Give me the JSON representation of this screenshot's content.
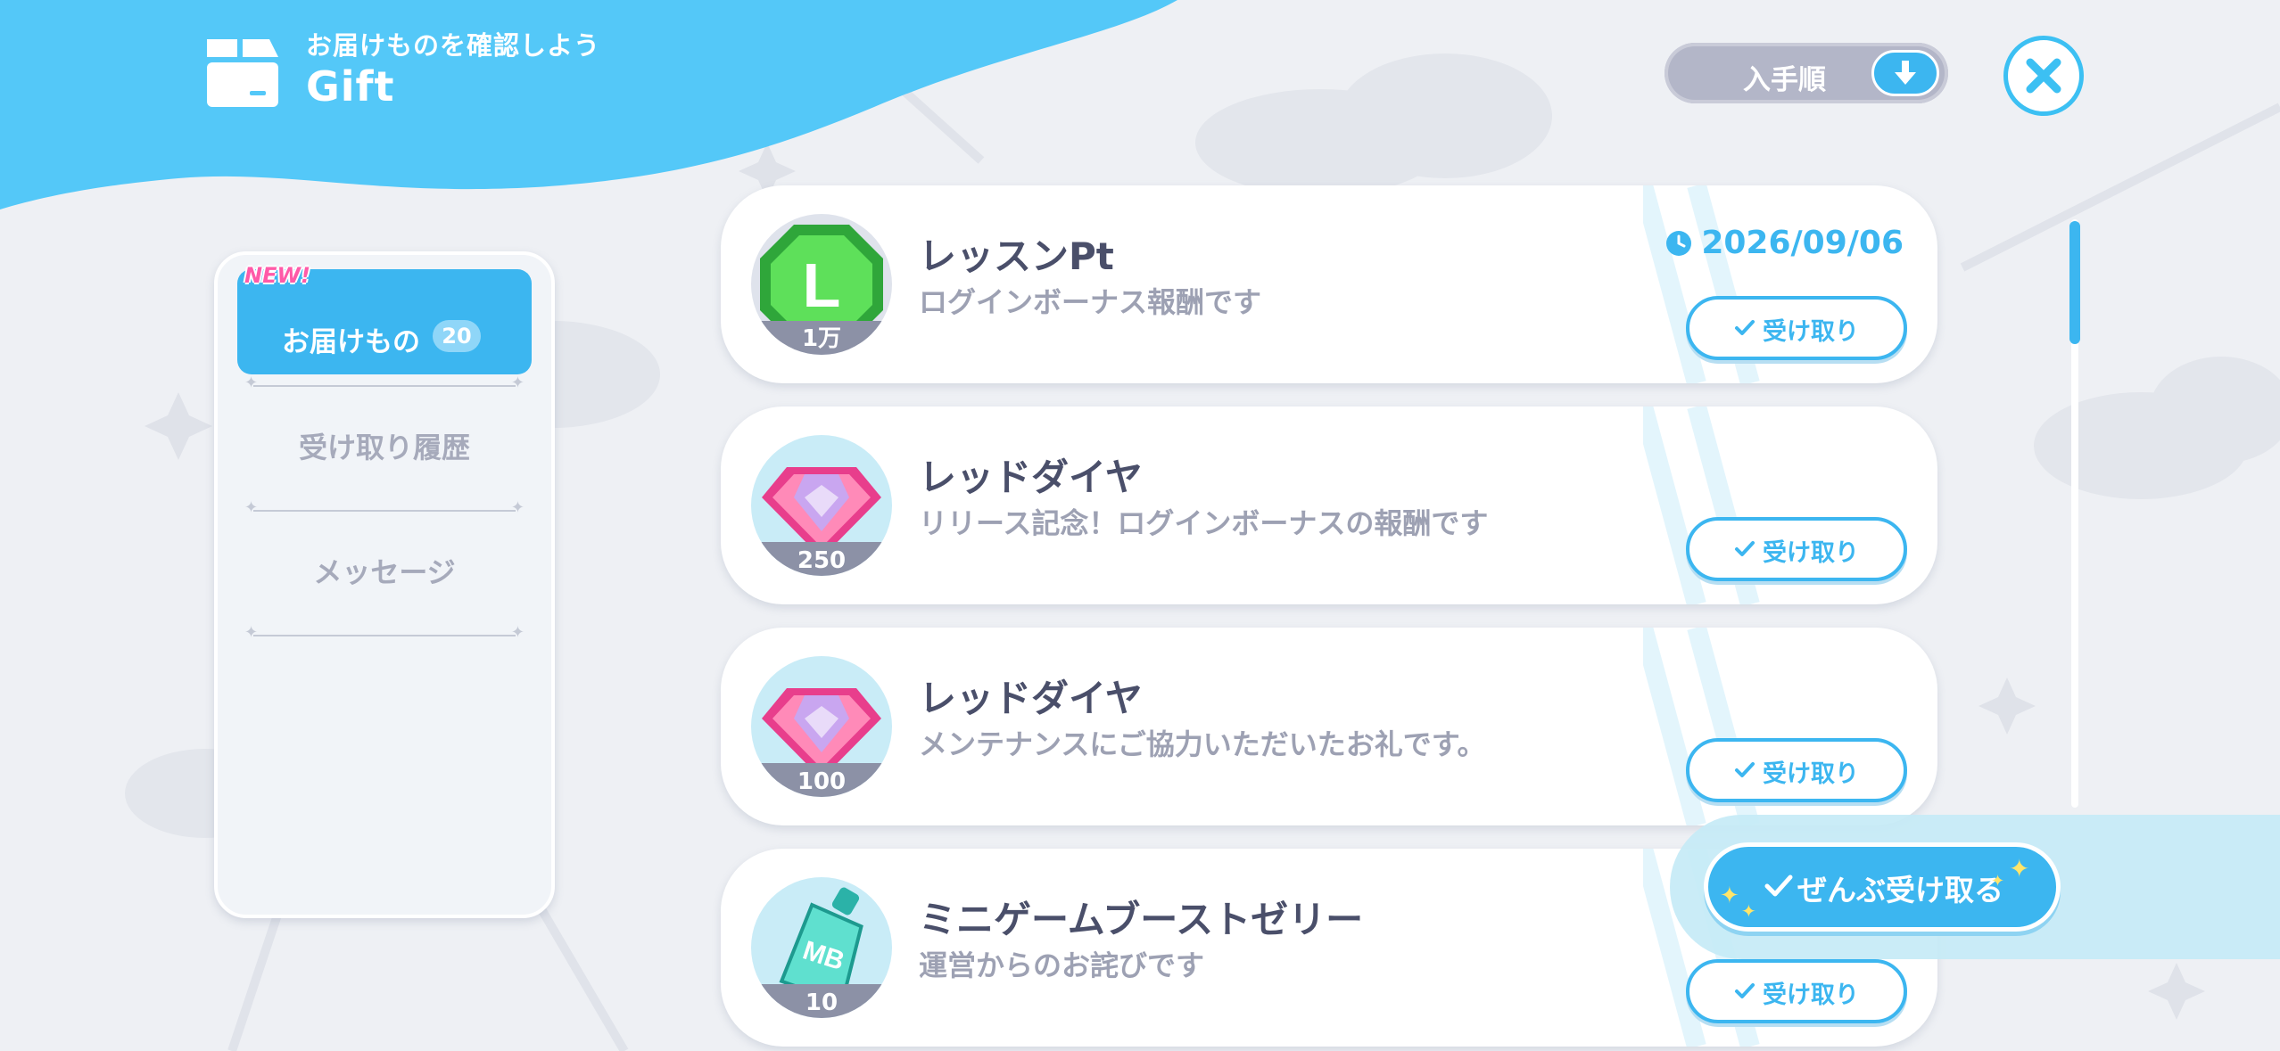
{
  "header": {
    "subtitle": "お届けものを確認しよう",
    "title": "Gift"
  },
  "sort": {
    "label": "入手順",
    "icon": "arrow-down-icon"
  },
  "close": {
    "icon": "close-icon"
  },
  "sidebar": {
    "active_tab": {
      "badge": "NEW!",
      "label": "お届けもの",
      "count": "20"
    },
    "tabs": [
      {
        "label": "受け取り履歴"
      },
      {
        "label": "メッセージ"
      }
    ]
  },
  "gifts": [
    {
      "name": "レッスンPt",
      "description": "ログインボーナス報酬です",
      "quantity": "1万",
      "icon": "lesson-pt-coin-icon",
      "expiry": "2026/09/06",
      "button_label": "受け取り"
    },
    {
      "name": "レッドダイヤ",
      "description": "リリース記念！ログインボーナスの報酬です",
      "quantity": "250",
      "icon": "red-diamond-icon",
      "button_label": "受け取り"
    },
    {
      "name": "レッドダイヤ",
      "description": "メンテナンスにご協力いただいたお礼です。",
      "quantity": "100",
      "icon": "red-diamond-icon",
      "button_label": "受け取り"
    },
    {
      "name": "ミニゲームブーストゼリー",
      "description": "運営からのお詫びです",
      "quantity": "10",
      "icon": "boost-jelly-pouch-icon",
      "button_label": "受け取り"
    }
  ],
  "claim_all": {
    "label": "ぜんぶ受け取る"
  },
  "colors": {
    "accent": "#3cb6f0",
    "background": "#eef0f4",
    "text": "#4a4f6a",
    "muted_text": "#9da1b3",
    "new_badge": "#ff5aa8"
  }
}
